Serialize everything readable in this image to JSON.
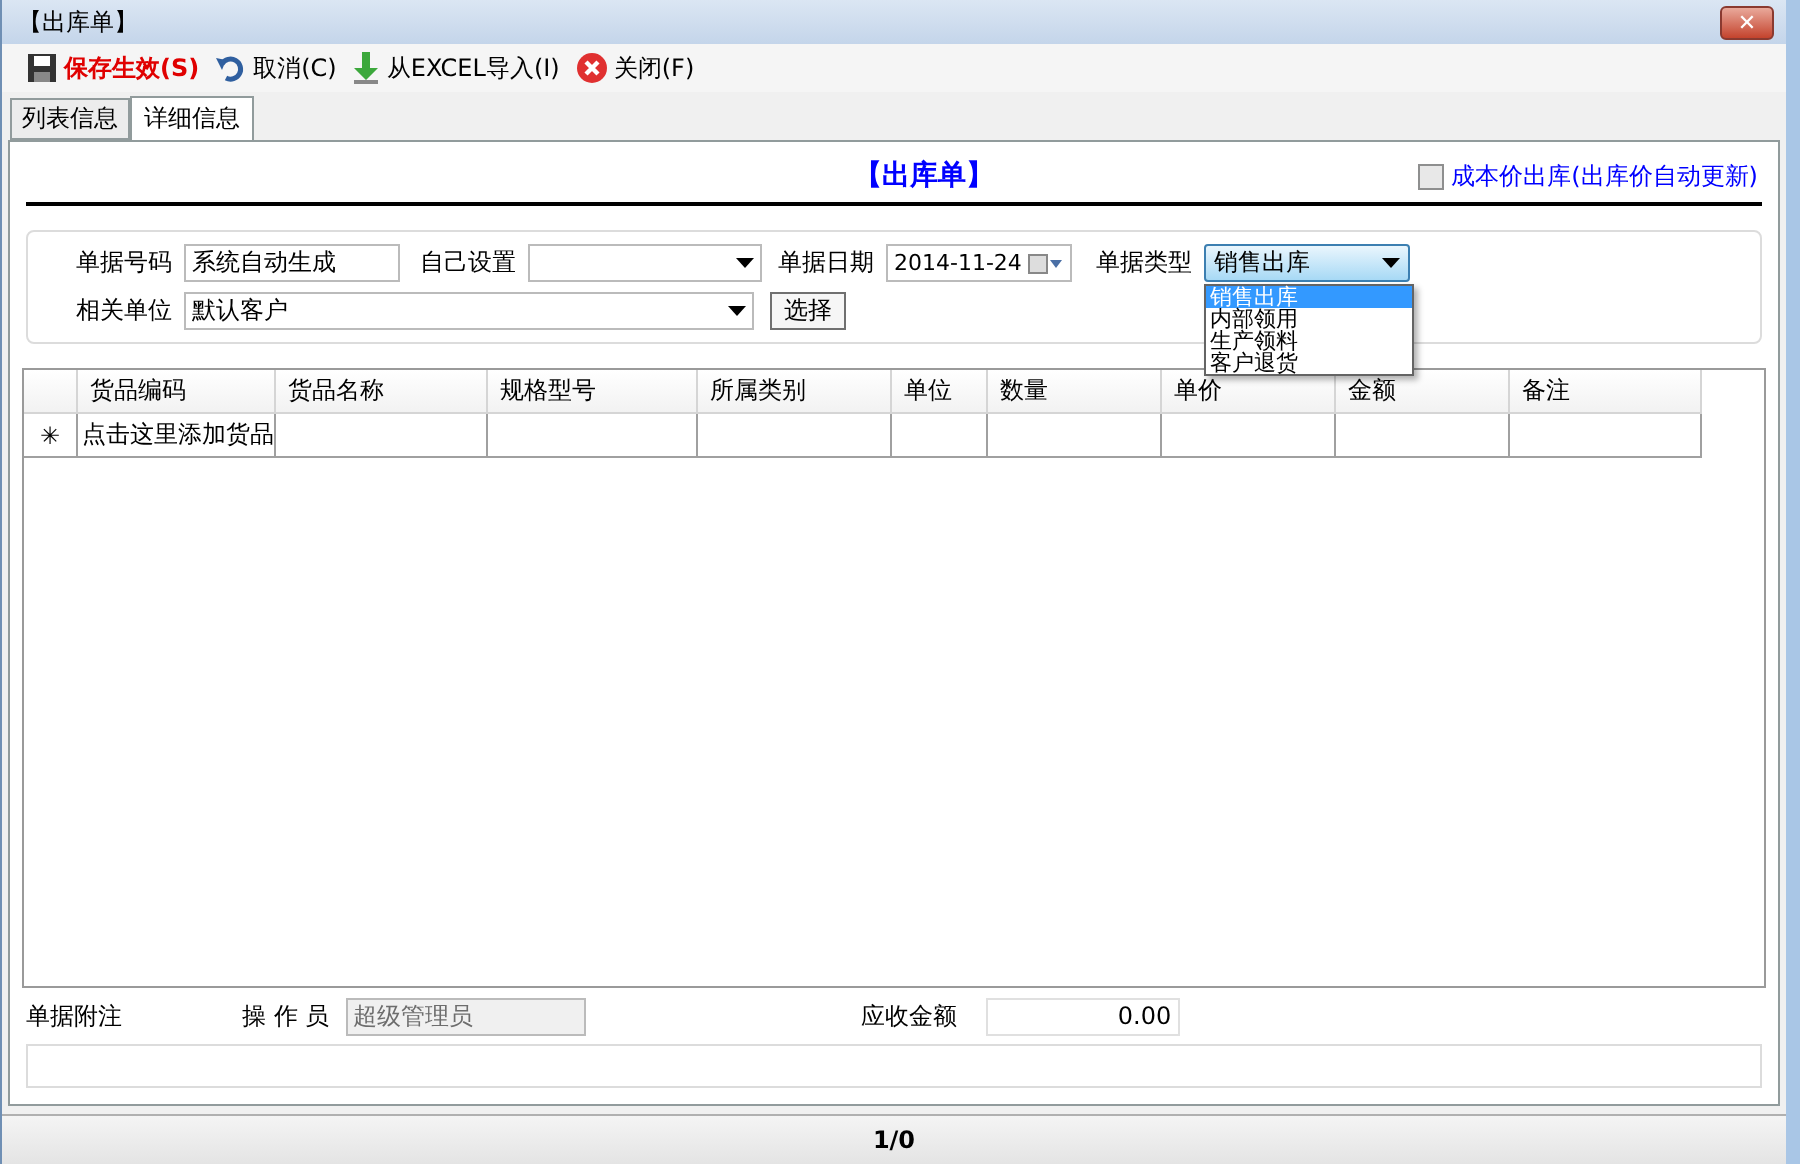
{
  "window": {
    "title": "【出库单】",
    "close_label": "✕"
  },
  "toolbar": [
    {
      "label": "保存生效(S)",
      "kind": "save"
    },
    {
      "label": "取消(C)",
      "kind": "cancel"
    },
    {
      "label": "从EXCEL导入(I)",
      "kind": "import"
    },
    {
      "label": "关闭(F)",
      "kind": "close"
    }
  ],
  "tabs": [
    {
      "label": "列表信息",
      "selected": false
    },
    {
      "label": "详细信息",
      "selected": true
    }
  ],
  "form_title": "【出库单】",
  "cost_checkbox": {
    "label": "成本价出库(出库价自动更新)",
    "checked": false
  },
  "fields": {
    "doc_no": {
      "label": "单据号码",
      "value": "系统自动生成"
    },
    "custom": {
      "label": "自己设置"
    },
    "date": {
      "label": "单据日期",
      "value": "2014-11-24"
    },
    "doc_type": {
      "label": "单据类型",
      "value": "销售出库",
      "expanded": true,
      "options": [
        {
          "label": "销售出库",
          "selected": true
        },
        {
          "label": "内部领用",
          "selected": false
        },
        {
          "label": "生产领料",
          "selected": false
        },
        {
          "label": "客户退货",
          "selected": false
        }
      ]
    },
    "partner": {
      "label": "相关单位",
      "value": "默认客户"
    },
    "choose_button": "选择"
  },
  "grid": {
    "columns": [
      "货品编码",
      "货品名称",
      "规格型号",
      "所属类别",
      "单位",
      "数量",
      "单价",
      "金额",
      "备注"
    ],
    "new_row": {
      "marker": "✳",
      "hint": "点击这里添加货品"
    }
  },
  "footer": {
    "note_label": "单据附注",
    "operator_label": "操 作 员",
    "operator": "超级管理员",
    "amount_label": "应收金额",
    "amount": "0.00"
  },
  "status_bar": "1/0"
}
